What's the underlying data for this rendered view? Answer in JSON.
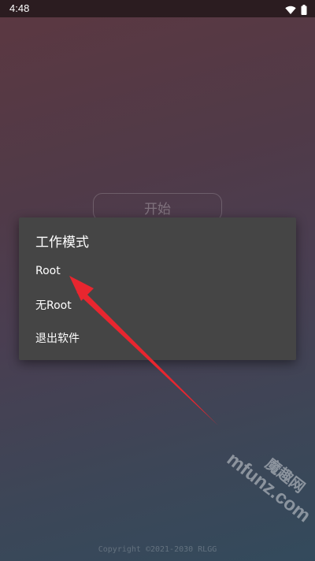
{
  "status_bar": {
    "time": "4:48",
    "icons": [
      "wifi-icon",
      "battery-icon"
    ]
  },
  "main": {
    "start_label": "开始",
    "copyright": "Copyright ©2021-2030 RLGG"
  },
  "dialog": {
    "title": "工作模式",
    "items": [
      {
        "label": "Root"
      },
      {
        "label": "无Root"
      },
      {
        "label": "退出软件"
      }
    ]
  },
  "annotation": {
    "arrow_color": "#e8262f",
    "points_to": "Root"
  },
  "watermark": {
    "cn": "魔趣网",
    "en": "mfunz.com"
  }
}
